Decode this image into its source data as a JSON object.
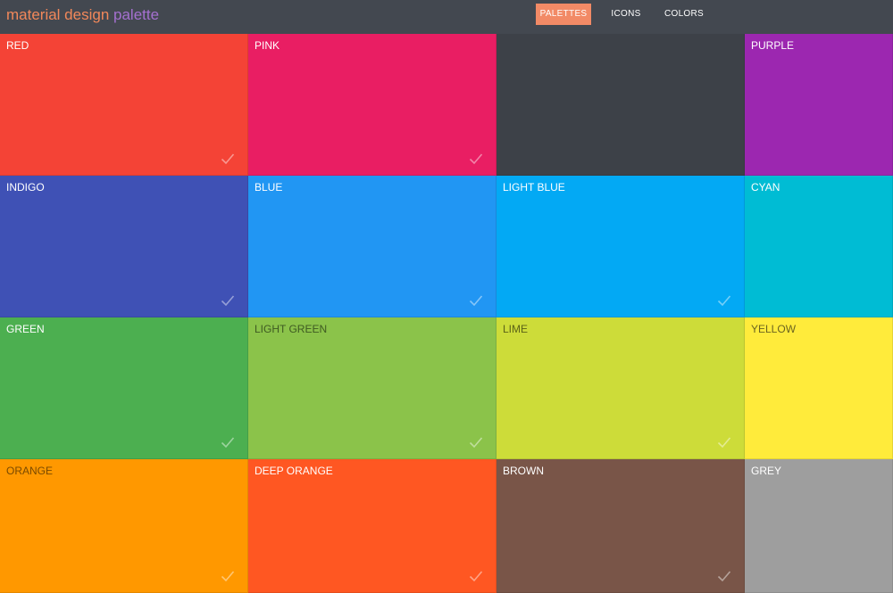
{
  "header": {
    "logo_part_a": "material design",
    "logo_part_b": "palette",
    "nav": [
      {
        "label": "PALETTES",
        "active": true
      },
      {
        "label": "ICONS",
        "active": false
      },
      {
        "label": "COLORS",
        "active": false
      }
    ]
  },
  "palette": [
    {
      "name": "RED",
      "color": "#f44336",
      "text_color": "#ffffff",
      "check": true
    },
    {
      "name": "PINK",
      "color": "#e91e63",
      "text_color": "#ffffff",
      "check": true
    },
    {
      "name": "",
      "color": "#3d4148",
      "text_color": "#ffffff",
      "check": false
    },
    {
      "name": "PURPLE",
      "color": "#9c27b0",
      "text_color": "#ffffff",
      "check": false
    },
    {
      "name": "INDIGO",
      "color": "#3f51b5",
      "text_color": "#ffffff",
      "check": true
    },
    {
      "name": "BLUE",
      "color": "#2196f3",
      "text_color": "#ffffff",
      "check": true
    },
    {
      "name": "LIGHT BLUE",
      "color": "#03a9f4",
      "text_color": "#ffffff",
      "check": true
    },
    {
      "name": "CYAN",
      "color": "#00bcd4",
      "text_color": "#ffffff",
      "check": false
    },
    {
      "name": "GREEN",
      "color": "#4caf50",
      "text_color": "#ffffff",
      "check": true
    },
    {
      "name": "LIGHT GREEN",
      "color": "#8bc34a",
      "text_color": "#3e5a22",
      "check": true
    },
    {
      "name": "LIME",
      "color": "#cddc39",
      "text_color": "#5b6218",
      "check": true
    },
    {
      "name": "YELLOW",
      "color": "#ffeb3b",
      "text_color": "#6b6420",
      "check": false
    },
    {
      "name": "ORANGE",
      "color": "#ff9800",
      "text_color": "#7a4a00",
      "check": true
    },
    {
      "name": "DEEP ORANGE",
      "color": "#ff5722",
      "text_color": "#ffffff",
      "check": true
    },
    {
      "name": "BROWN",
      "color": "#795548",
      "text_color": "#ffffff",
      "check": true
    },
    {
      "name": "GREY",
      "color": "#9e9e9e",
      "text_color": "#ffffff",
      "check": false
    }
  ]
}
